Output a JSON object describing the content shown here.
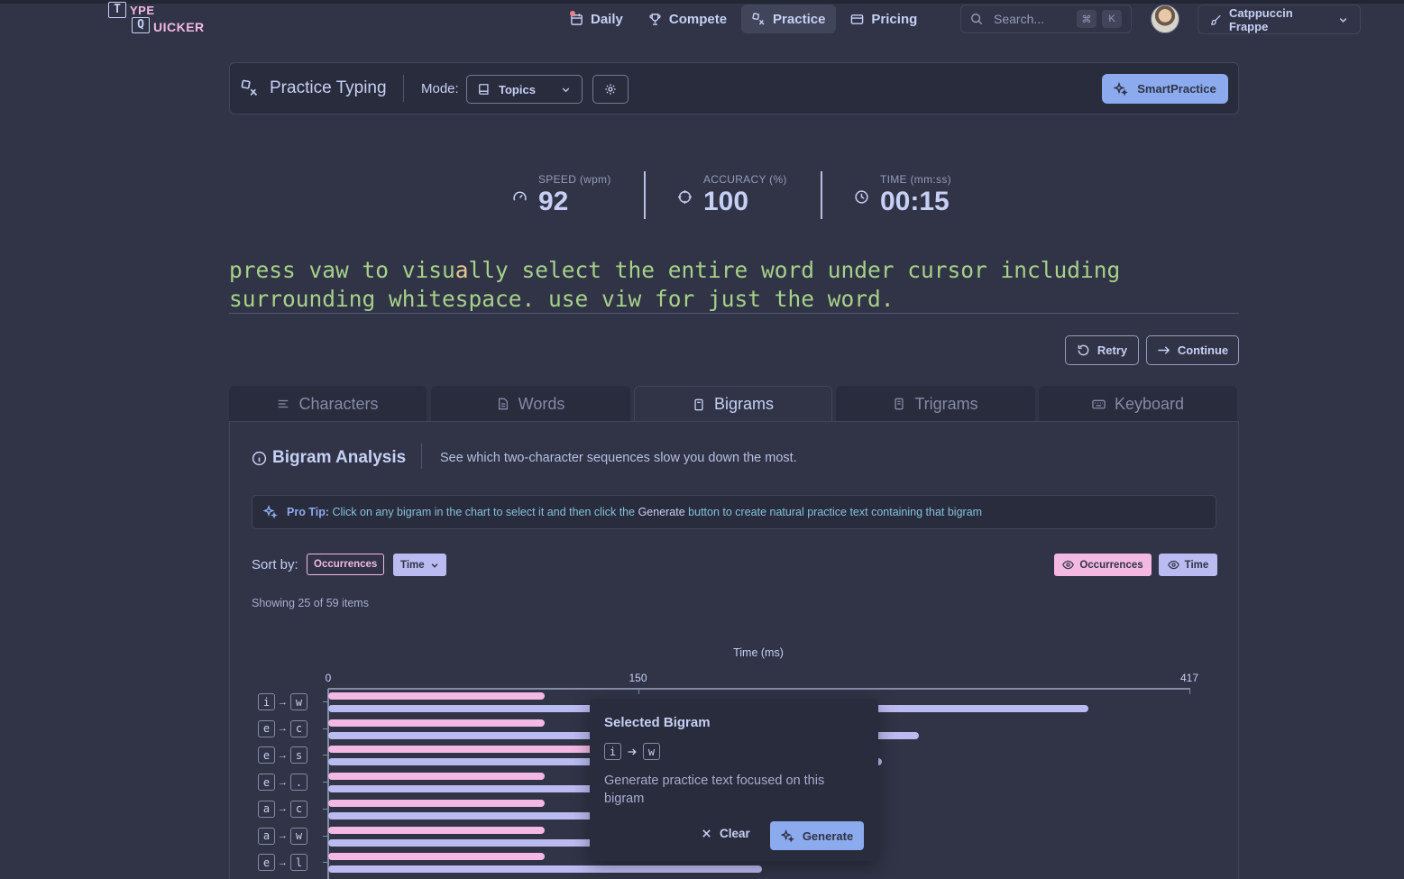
{
  "logo": {
    "box1": "T",
    "text1": "YPE",
    "box2": "Q",
    "text2": "UICKER"
  },
  "nav": {
    "daily": "Daily",
    "compete": "Compete",
    "practice": "Practice",
    "pricing": "Pricing"
  },
  "search": {
    "placeholder": "Search...",
    "kbd_cmd": "⌘",
    "kbd_key": "K"
  },
  "theme": {
    "label": "Catppuccin Frappe"
  },
  "header": {
    "title": "Practice Typing",
    "mode_label": "Mode:",
    "mode_value": "Topics",
    "smart_label": "SmartPractice"
  },
  "stats": {
    "speed_label": "SPEED (wpm)",
    "speed_value": "92",
    "accuracy_label": "ACCURACY (%)",
    "accuracy_value": "100",
    "time_label": "TIME (mm:ss)",
    "time_value": "00:15"
  },
  "typing": {
    "before_cursor": "press vaw to visu",
    "cursor_char": "a",
    "after_cursor": "lly select the entire word under cursor including surrounding whitespace. use viw for just the word."
  },
  "actions": {
    "retry": "Retry",
    "continue": "Continue"
  },
  "tabs": [
    {
      "label": "Characters"
    },
    {
      "label": "Words"
    },
    {
      "label": "Bigrams"
    },
    {
      "label": "Trigrams"
    },
    {
      "label": "Keyboard"
    }
  ],
  "analysis": {
    "title": "Bigram Analysis",
    "description": "See which two-character sequences slow you down the most.",
    "tip_prefix": "Pro Tip:",
    "tip_text_1": "Click on any bigram in the chart to select it and then click the",
    "tip_generate": "Generate",
    "tip_text_2": "button to create natural practice text containing that bigram",
    "sort_label": "Sort by:",
    "sort_occurrences": "Occurrences",
    "sort_time": "Time",
    "toggle_occurrences": "Occurrences",
    "toggle_time": "Time",
    "showing": "Showing 25 of 59 items"
  },
  "chart_data": {
    "type": "bar",
    "title": "Time (ms)",
    "orientation": "horizontal",
    "xlim": [
      0,
      417
    ],
    "xticks": [
      0,
      150,
      417
    ],
    "categories": [
      {
        "from": "i",
        "to": "w"
      },
      {
        "from": "e",
        "to": "c"
      },
      {
        "from": "e",
        "to": "s"
      },
      {
        "from": "e",
        "to": "."
      },
      {
        "from": "a",
        "to": "c"
      },
      {
        "from": "a",
        "to": "w"
      },
      {
        "from": "e",
        "to": "l"
      }
    ],
    "series": [
      {
        "name": "Occurrences",
        "color": "#f4b8e4",
        "values": [
          105,
          105,
          130,
          105,
          105,
          105,
          105
        ]
      },
      {
        "name": "Time",
        "color": "#babbf1",
        "values": [
          368,
          286,
          268,
          250,
          245,
          240,
          210
        ]
      }
    ]
  },
  "popover": {
    "title": "Selected Bigram",
    "key_from": "i",
    "key_to": "w",
    "description": "Generate practice text focused on this bigram",
    "clear": "Clear",
    "generate": "Generate"
  }
}
